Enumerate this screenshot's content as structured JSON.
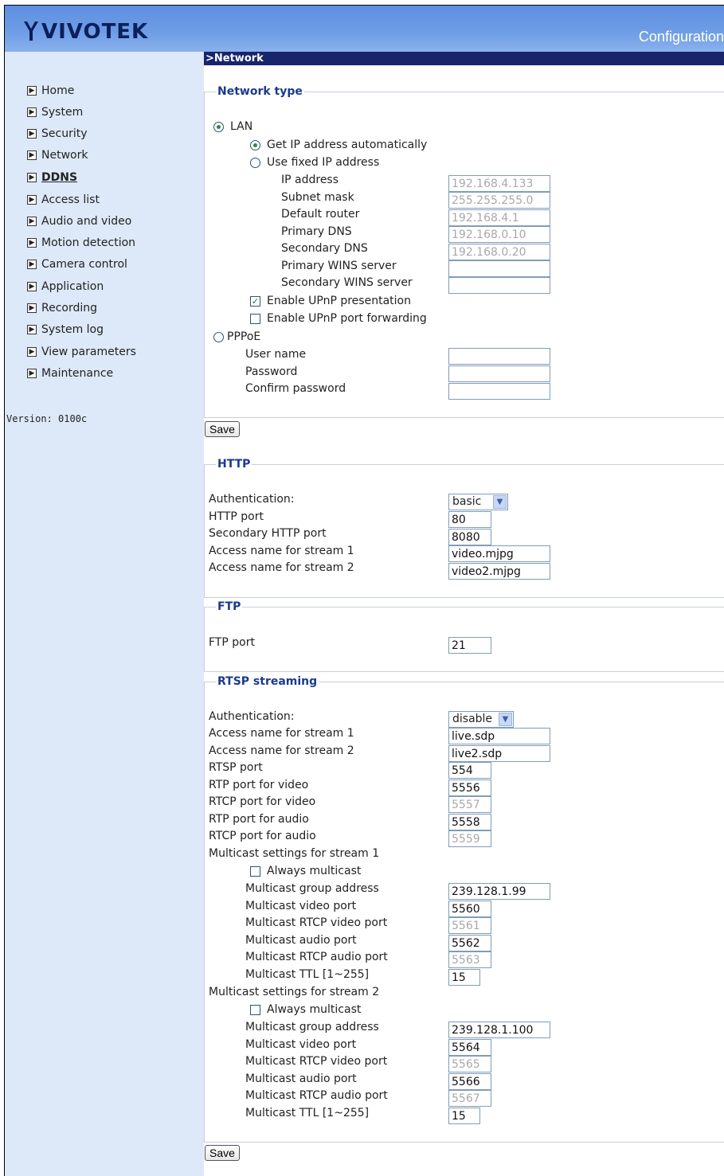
{
  "header": {
    "brand": "VIVOTEK",
    "title": "Configuration"
  },
  "page_title": ">Network",
  "sidebar": {
    "items": [
      {
        "label": "Home"
      },
      {
        "label": "System"
      },
      {
        "label": "Security"
      },
      {
        "label": "Network"
      },
      {
        "label": "DDNS"
      },
      {
        "label": "Access list"
      },
      {
        "label": "Audio and video"
      },
      {
        "label": "Motion detection"
      },
      {
        "label": "Camera control"
      },
      {
        "label": "Application"
      },
      {
        "label": "Recording"
      },
      {
        "label": "System log"
      },
      {
        "label": "View parameters"
      },
      {
        "label": "Maintenance"
      }
    ],
    "active": "DDNS",
    "version": "Version: 0100c"
  },
  "network_type": {
    "legend": "Network type",
    "lan": "LAN",
    "auto_ip": "Get IP address automatically",
    "fixed_ip": "Use fixed IP address",
    "fields": [
      {
        "label": "IP address",
        "value": "192.168.4.133"
      },
      {
        "label": "Subnet mask",
        "value": "255.255.255.0"
      },
      {
        "label": "Default router",
        "value": "192.168.4.1"
      },
      {
        "label": "Primary DNS",
        "value": "192.168.0.10"
      },
      {
        "label": "Secondary DNS",
        "value": "192.168.0.20"
      },
      {
        "label": "Primary WINS server",
        "value": ""
      },
      {
        "label": "Secondary WINS server",
        "value": ""
      }
    ],
    "upnp_presentation": "Enable UPnP presentation",
    "upnp_port": "Enable UPnP port forwarding",
    "pppoe": "PPPoE",
    "pppoe_fields": [
      {
        "label": "User name",
        "value": ""
      },
      {
        "label": "Password",
        "value": ""
      },
      {
        "label": "Confirm password",
        "value": ""
      }
    ]
  },
  "save_label": "Save",
  "http": {
    "legend": "HTTP",
    "auth_label": "Authentication:",
    "auth_value": "basic",
    "fields": [
      {
        "label": "HTTP port",
        "value": "80"
      },
      {
        "label": "Secondary HTTP port",
        "value": "8080"
      },
      {
        "label": "Access name for stream 1",
        "value": "video.mjpg"
      },
      {
        "label": "Access name for stream 2",
        "value": "video2.mjpg"
      }
    ]
  },
  "ftp": {
    "legend": "FTP",
    "port_label": "FTP port",
    "port_value": "21"
  },
  "rtsp": {
    "legend": "RTSP streaming",
    "auth_label": "Authentication:",
    "auth_value": "disable",
    "fields": [
      {
        "label": "Access name for stream 1",
        "value": "live.sdp"
      },
      {
        "label": "Access name for stream 2",
        "value": "live2.sdp"
      },
      {
        "label": "RTSP port",
        "value": "554"
      },
      {
        "label": "RTP port for video",
        "value": "5556"
      },
      {
        "label": "RTCP port for video",
        "value": "5557"
      },
      {
        "label": "RTP port for audio",
        "value": "5558"
      },
      {
        "label": "RTCP port for audio",
        "value": "5559"
      }
    ],
    "multicast": [
      {
        "title": "Multicast settings for stream 1",
        "always": "Always multicast",
        "fields": [
          {
            "label": "Multicast group address",
            "value": "239.128.1.99"
          },
          {
            "label": "Multicast video port",
            "value": "5560"
          },
          {
            "label": "Multicast RTCP video port",
            "value": "5561"
          },
          {
            "label": "Multicast audio port",
            "value": "5562"
          },
          {
            "label": "Multicast RTCP audio port",
            "value": "5563"
          },
          {
            "label": "Multicast TTL [1~255]",
            "value": "15"
          }
        ]
      },
      {
        "title": "Multicast settings for stream 2",
        "always": "Always multicast",
        "fields": [
          {
            "label": "Multicast group address",
            "value": "239.128.1.100"
          },
          {
            "label": "Multicast video port",
            "value": "5564"
          },
          {
            "label": "Multicast RTCP video port",
            "value": "5565"
          },
          {
            "label": "Multicast audio port",
            "value": "5566"
          },
          {
            "label": "Multicast RTCP audio port",
            "value": "5567"
          },
          {
            "label": "Multicast TTL [1~255]",
            "value": "15"
          }
        ]
      }
    ]
  }
}
